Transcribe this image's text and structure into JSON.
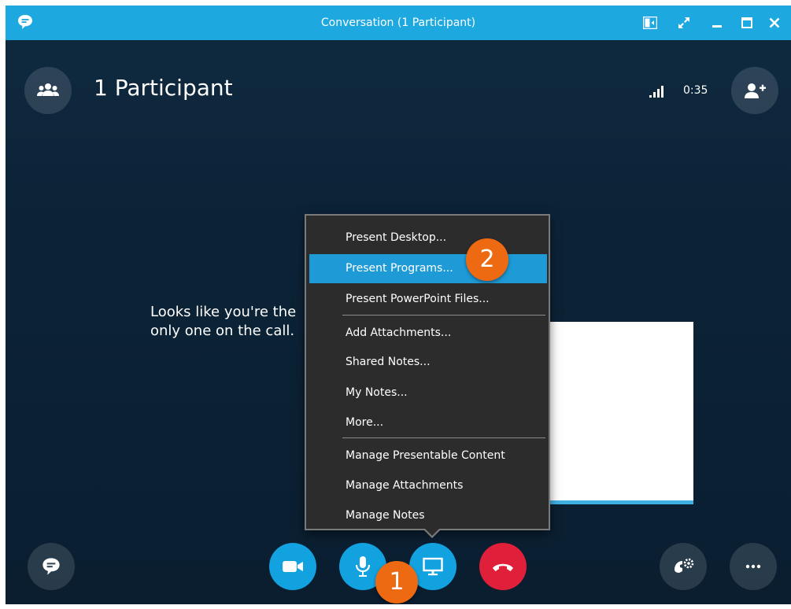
{
  "window": {
    "title": "Conversation (1 Participant)"
  },
  "header": {
    "participant_title": "1 Participant",
    "call_duration": "0:35"
  },
  "main": {
    "message": "Looks like you're the only one on the call."
  },
  "present_menu": {
    "items": [
      {
        "label": "Present Desktop...",
        "active": false
      },
      {
        "label": "Present Programs...",
        "active": true
      },
      {
        "label": "Present PowerPoint Files...",
        "active": false
      },
      {
        "label": "Add Attachments...",
        "active": false
      },
      {
        "label": "Shared Notes...",
        "active": false
      },
      {
        "label": "My Notes...",
        "active": false
      },
      {
        "label": "More...",
        "active": false
      },
      {
        "label": "Manage Presentable Content",
        "active": false
      },
      {
        "label": "Manage Attachments",
        "active": false
      },
      {
        "label": "Manage Notes",
        "active": false
      }
    ]
  },
  "callouts": {
    "step1": "1",
    "step2": "2"
  },
  "colors": {
    "titlebar": "#1ea8e0",
    "accent_blue": "#13a2e0",
    "hangup_red": "#e0203a",
    "callout_orange": "#ee6a12",
    "menu_highlight": "#1e9ad6"
  },
  "icons": {
    "app_logo": "chat-bubble-icon",
    "participants": "people-group-icon",
    "add_participant": "add-person-icon",
    "signal": "signal-bars-icon",
    "chat": "chat-bubble-icon",
    "video": "video-camera-icon",
    "mic": "microphone-icon",
    "present": "monitor-icon",
    "hangup": "phone-hangup-icon",
    "call_controls": "phone-settings-icon",
    "more": "ellipsis-icon"
  }
}
